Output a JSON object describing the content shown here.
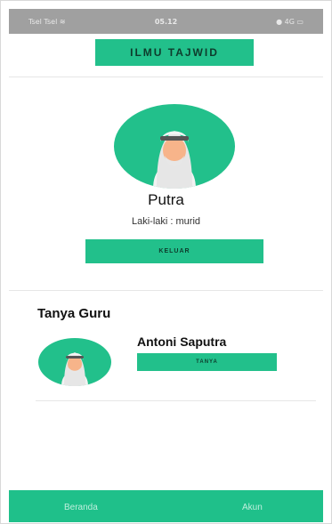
{
  "status_bar": {
    "left": "Tsel Tsel ≋",
    "time": "05.12",
    "right": "● 4G ▭"
  },
  "header": {
    "title": "ILMU TAJWID"
  },
  "profile": {
    "name": "Putra",
    "role": "Laki-laki : murid",
    "logout_label": "KELUAR"
  },
  "ask_teacher": {
    "title": "Tanya Guru",
    "teachers": [
      {
        "name": "Antoni Saputra",
        "ask_label": "TANYA"
      }
    ]
  },
  "bottom_nav": {
    "items": [
      {
        "label": "Beranda"
      },
      {
        "label": "Akun"
      }
    ]
  },
  "colors": {
    "accent": "#22c08b",
    "nav": "#1fc08a"
  },
  "icons": {
    "avatar": "person-keffiyeh-icon"
  }
}
